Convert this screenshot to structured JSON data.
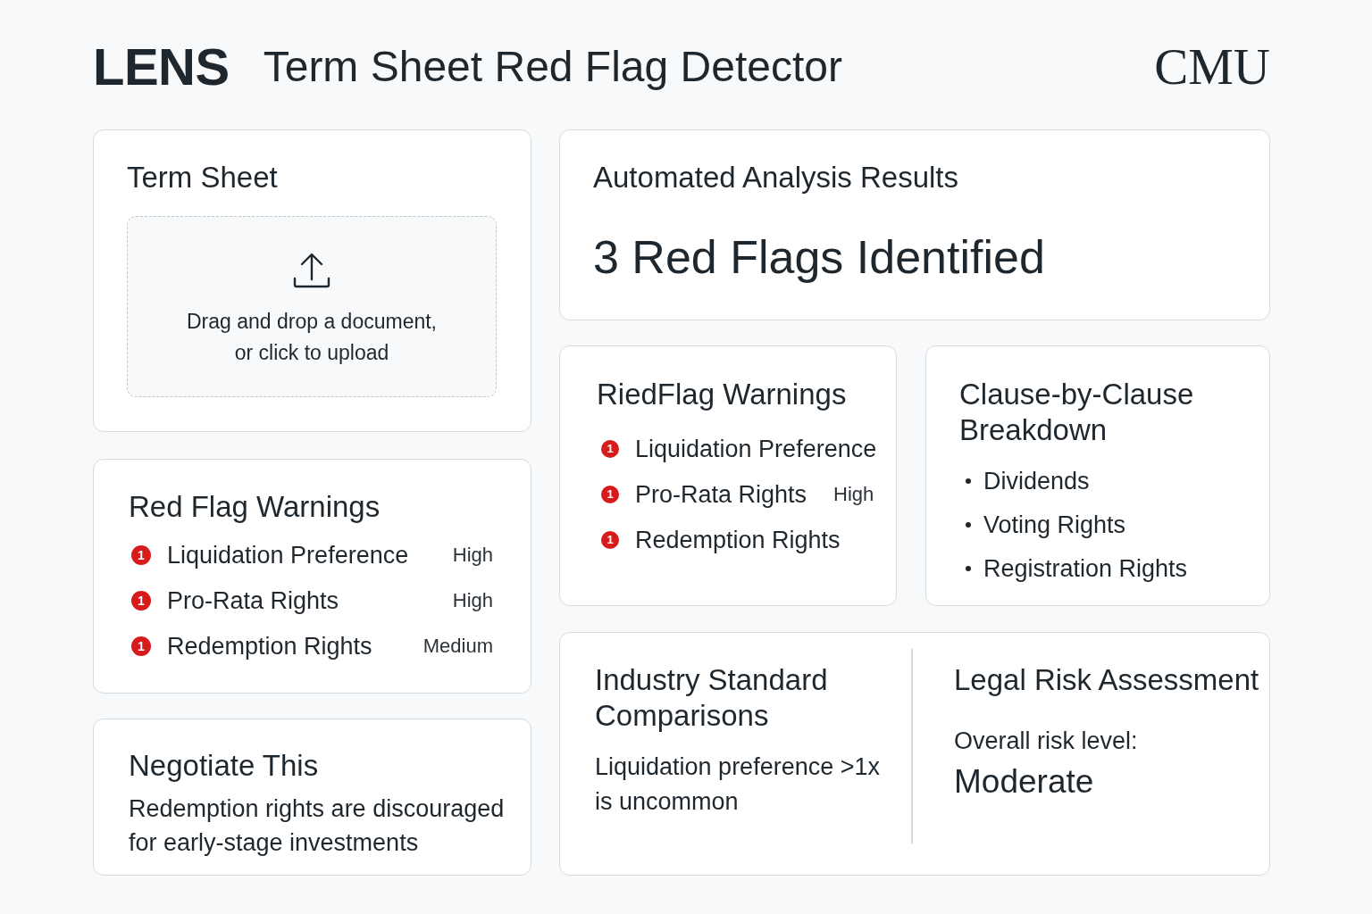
{
  "header": {
    "logo": "LENS",
    "title": "Term Sheet Red Flag Detector",
    "brand": "CMU"
  },
  "term_sheet": {
    "title": "Term Sheet",
    "dropzone": {
      "text": "Drag and drop a document, or click to upload"
    }
  },
  "red_flag_warnings": {
    "title": "Red Flag Warnings",
    "items": [
      {
        "badge": "1",
        "label": "Liquidation Preference",
        "severity": "High"
      },
      {
        "badge": "1",
        "label": "Pro-Rata Rights",
        "severity": "High"
      },
      {
        "badge": "1",
        "label": "Redemption Rights",
        "severity": "Medium"
      }
    ]
  },
  "negotiate": {
    "title": "Negotiate This",
    "text": "Redemption rights are discouraged for early-stage investments"
  },
  "analysis_results": {
    "title": "Automated Analysis Results",
    "headline": "3 Red Flags Identified"
  },
  "ried_flag_warnings": {
    "title": "RiedFlag Warnings",
    "items": [
      {
        "badge": "1",
        "label": "Liquidation Preference"
      },
      {
        "badge": "1",
        "label": "Pro-Rata Rights",
        "severity": "High"
      },
      {
        "badge": "1",
        "label": "Redemption Rights"
      }
    ]
  },
  "clause_breakdown": {
    "title": "Clause-by-Clause Breakdown",
    "items": [
      "Dividends",
      "Voting Rights",
      "Registration Rights"
    ]
  },
  "industry_comparisons": {
    "title": "Industry Standard Comparisons",
    "text": "Liquidation preference >1x is uncommon"
  },
  "legal_risk": {
    "title": "Legal Risk Assessment",
    "label": "Overall risk level:",
    "value": "Moderate"
  }
}
